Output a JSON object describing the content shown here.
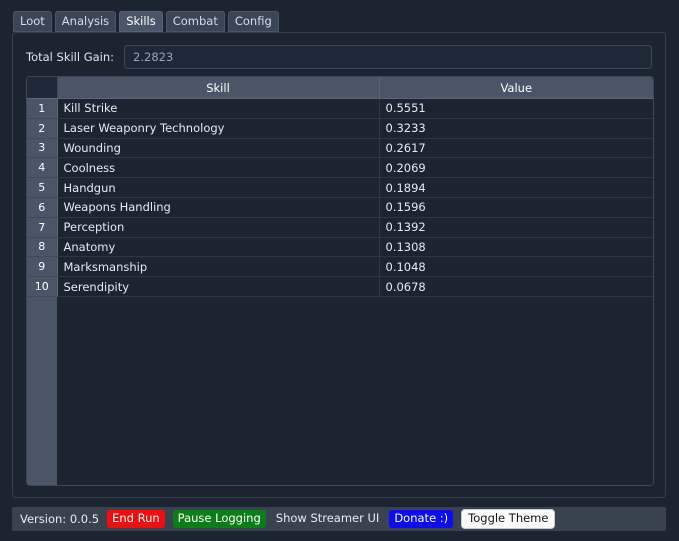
{
  "tabs": [
    {
      "label": "Loot",
      "active": false
    },
    {
      "label": "Analysis",
      "active": false
    },
    {
      "label": "Skills",
      "active": true
    },
    {
      "label": "Combat",
      "active": false
    },
    {
      "label": "Config",
      "active": false
    }
  ],
  "skills_panel": {
    "total_gain_label": "Total Skill Gain:",
    "total_gain_value": "2.2823",
    "total_gain_placeholder": "2.2823"
  },
  "table": {
    "columns": [
      "Skill",
      "Value"
    ],
    "rows": [
      {
        "index": "1",
        "skill": "Kill Strike",
        "value": "0.5551"
      },
      {
        "index": "2",
        "skill": "Laser Weaponry Technology",
        "value": "0.3233"
      },
      {
        "index": "3",
        "skill": "Wounding",
        "value": "0.2617"
      },
      {
        "index": "4",
        "skill": "Coolness",
        "value": "0.2069"
      },
      {
        "index": "5",
        "skill": "Handgun",
        "value": "0.1894"
      },
      {
        "index": "6",
        "skill": "Weapons Handling",
        "value": "0.1596"
      },
      {
        "index": "7",
        "skill": "Perception",
        "value": "0.1392"
      },
      {
        "index": "8",
        "skill": "Anatomy",
        "value": "0.1308"
      },
      {
        "index": "9",
        "skill": "Marksmanship",
        "value": "0.1048"
      },
      {
        "index": "10",
        "skill": "Serendipity",
        "value": "0.0678"
      }
    ]
  },
  "statusbar": {
    "version": "Version: 0.0.5",
    "end_run": "End Run",
    "pause_logging": "Pause Logging",
    "show_streamer_ui": "Show Streamer UI",
    "donate": "Donate :)",
    "toggle_theme": "Toggle Theme"
  },
  "colors": {
    "window_bg": "#1b2430",
    "panel_border": "#36404f",
    "tab_active_underline": "#2b7fd4",
    "tab_bg": "#3a4656",
    "tab_active_bg": "#4a5668",
    "header_bg": "#4a5668",
    "gutter_bg": "#4a5668",
    "statusbar_bg": "#39424f",
    "end_run_bg": "#ef0d0d",
    "pause_logging_bg": "#0a7f18",
    "donate_bg": "#0c0cf2",
    "toggle_theme_bg": "#fbfbfb",
    "text_primary": "#e6ebf2",
    "text_muted": "#9aa6b6"
  }
}
